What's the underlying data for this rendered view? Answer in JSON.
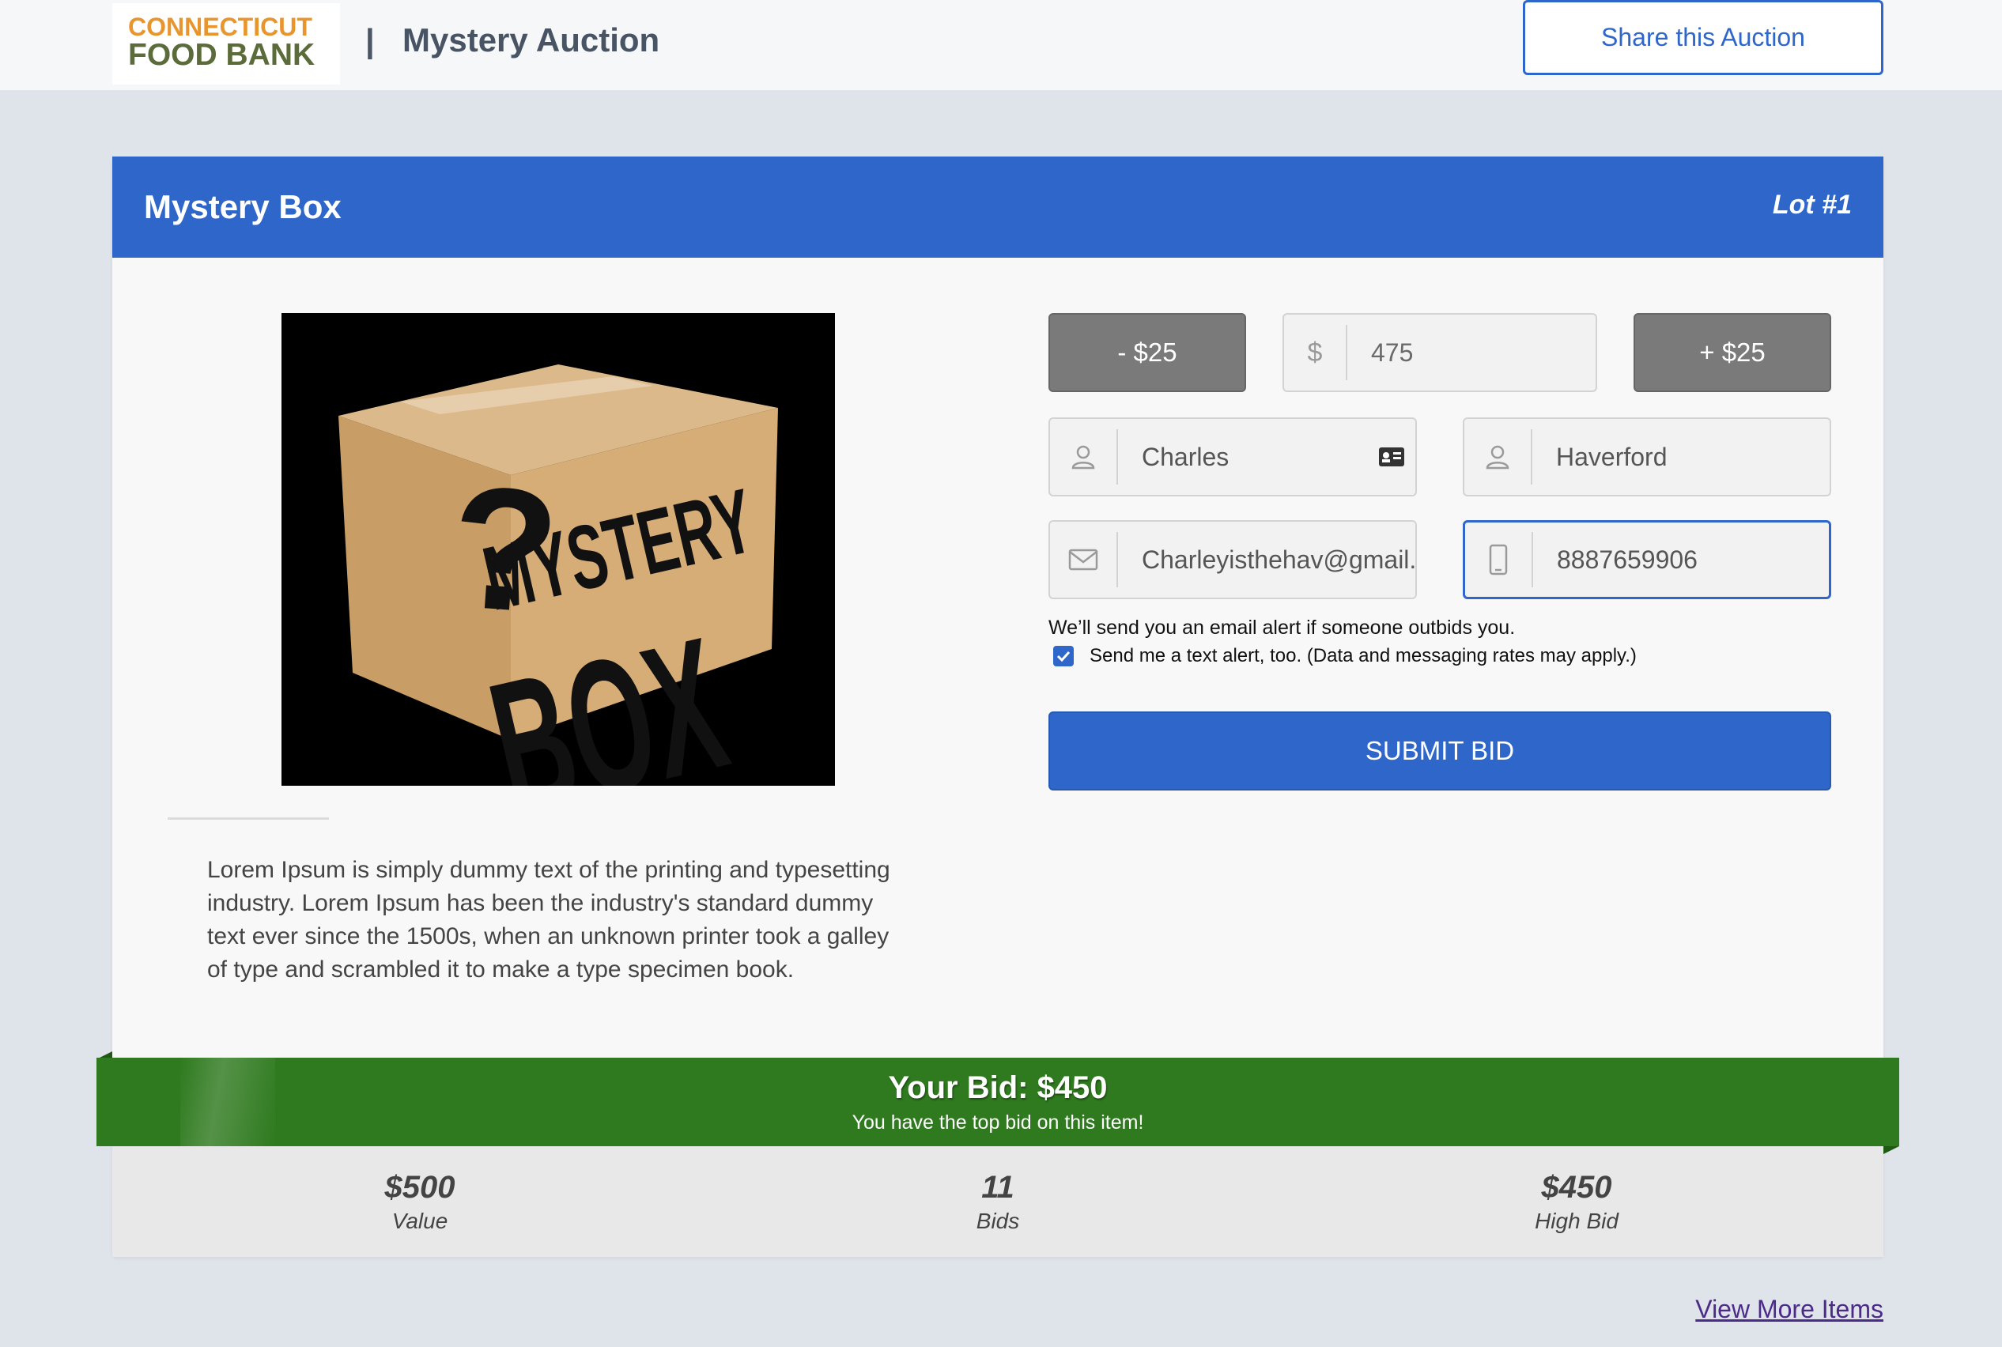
{
  "header": {
    "logo_line1": "CONNECTICUT",
    "logo_line2": "FOOD BANK",
    "separator": "|",
    "title": "Mystery Auction",
    "share_label": "Share this Auction"
  },
  "item": {
    "title": "Mystery Box",
    "lot": "Lot #1",
    "image_text_line1": "MYSTERY",
    "image_text_line2": "BOX",
    "description": "Lorem Ipsum is simply dummy text of the printing and typesetting industry. Lorem Ipsum has been the industry's standard dummy text ever since the 1500s, when an unknown printer took a galley of type and scrambled it to make a type specimen book."
  },
  "bid_form": {
    "decrement_label": "- $25",
    "increment_label": "+ $25",
    "amount_value": "475",
    "currency_symbol": "$",
    "first_name": "Charles",
    "last_name": "Haverford",
    "email": "Charleyisthehav@gmail.com",
    "phone": "8887659906",
    "email_alert_text": "We’ll send you an email alert if someone outbids you.",
    "text_alert_label": "Send me a text alert, too. (Data and messaging rates may apply.)",
    "text_alert_checked": true,
    "submit_label": "SUBMIT BID"
  },
  "status": {
    "your_bid": "Your Bid: $450",
    "message": "You have the top bid on this item!"
  },
  "stats": [
    {
      "value": "$500",
      "label": "Value"
    },
    {
      "value": "11",
      "label": "Bids"
    },
    {
      "value": "$450",
      "label": "High Bid"
    }
  ],
  "footer": {
    "view_more": "View More Items"
  },
  "colors": {
    "primary": "#2e66c9",
    "ribbon": "#2f7a1f",
    "stepper": "#7a7a7a"
  }
}
